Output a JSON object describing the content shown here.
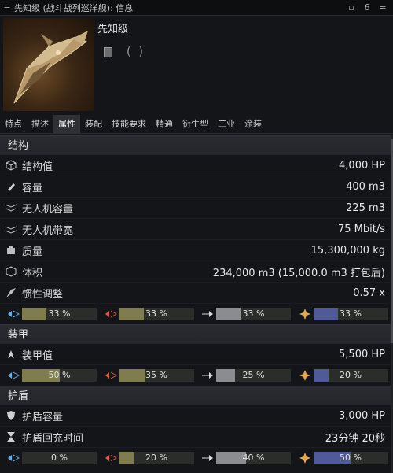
{
  "window": {
    "title": "先知级 (战斗战列巡洋舰): 信息",
    "menu_glyph": "≡",
    "ctrl_minimize": "▫",
    "ctrl_pin": "6",
    "ctrl_close": "="
  },
  "ship": {
    "name": "先知级"
  },
  "tabs": [
    "特点",
    "描述",
    "属性",
    "装配",
    "技能要求",
    "精通",
    "衍生型",
    "工业",
    "涂装"
  ],
  "active_tab": "属性",
  "sections": {
    "structure": {
      "title": "结构",
      "rows": [
        {
          "label": "结构值",
          "value": "4,000 HP",
          "icon": "cube-icon"
        },
        {
          "label": "容量",
          "value": "400 m3",
          "icon": "cargo-icon"
        },
        {
          "label": "无人机容量",
          "value": "225 m3",
          "icon": "drone-bay-icon"
        },
        {
          "label": "无人机带宽",
          "value": "75 Mbit/s",
          "icon": "drone-bandwidth-icon"
        },
        {
          "label": "质量",
          "value": "15,300,000 kg",
          "icon": "mass-icon"
        },
        {
          "label": "体积",
          "value": "234,000 m3 (15,000.0 m3 打包后)",
          "icon": "volume-icon"
        },
        {
          "label": "惯性调整",
          "value": "0.57 x",
          "icon": "inertia-icon"
        }
      ],
      "resists": [
        {
          "pct": 0.33,
          "text": "33 %",
          "color": "#7f7c4f"
        },
        {
          "pct": 0.33,
          "text": "33 %",
          "color": "#7f7c4f"
        },
        {
          "pct": 0.33,
          "text": "33 %",
          "color": "#8a8c8f"
        },
        {
          "pct": 0.33,
          "text": "33 %",
          "color": "#4f5a96"
        }
      ]
    },
    "armor": {
      "title": "装甲",
      "rows": [
        {
          "label": "装甲值",
          "value": "5,500 HP",
          "icon": "armor-icon"
        }
      ],
      "resists": [
        {
          "pct": 0.5,
          "text": "50 %",
          "color": "#7f7c4f"
        },
        {
          "pct": 0.35,
          "text": "35 %",
          "color": "#7f7c4f"
        },
        {
          "pct": 0.25,
          "text": "25 %",
          "color": "#8a8c8f"
        },
        {
          "pct": 0.2,
          "text": "20 %",
          "color": "#4f5a96"
        }
      ]
    },
    "shield": {
      "title": "护盾",
      "rows": [
        {
          "label": "护盾容量",
          "value": "3,000 HP",
          "icon": "shield-icon"
        },
        {
          "label": "护盾回充时间",
          "value": "23分钟 20秒",
          "icon": "hourglass-icon"
        }
      ],
      "resists": [
        {
          "pct": 0.0,
          "text": "0 %",
          "color": "#7f7c4f"
        },
        {
          "pct": 0.2,
          "text": "20 %",
          "color": "#7f7c4f"
        },
        {
          "pct": 0.4,
          "text": "40 %",
          "color": "#8a8c8f"
        },
        {
          "pct": 0.5,
          "text": "50 %",
          "color": "#4f5a96"
        }
      ]
    }
  },
  "resist_icons": [
    "em-icon",
    "thermal-icon",
    "kinetic-icon",
    "explosive-icon"
  ]
}
